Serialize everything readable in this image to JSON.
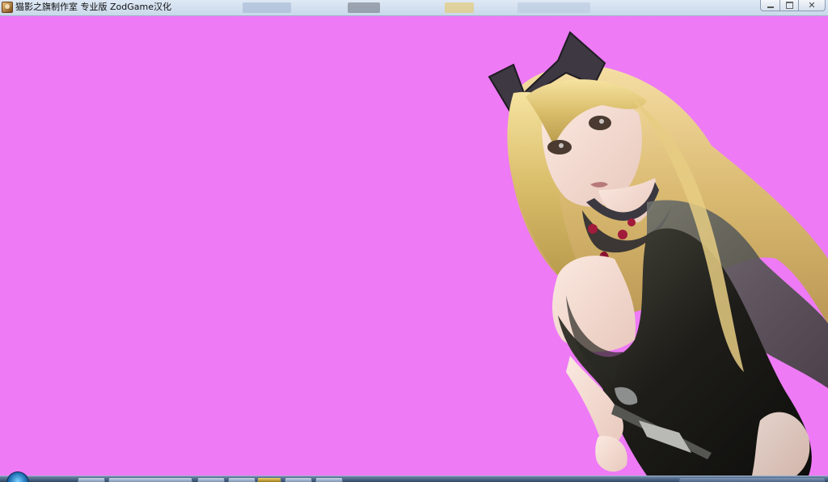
{
  "window": {
    "title": "猫影之旗制作室 专业版 ZodGame汉化",
    "controls": {
      "minimize_icon": "minimize-icon",
      "maximize_icon": "maximize-icon",
      "close_icon": "close-icon"
    }
  },
  "viewport": {
    "background_color": "#ee7af6",
    "content": "3d-character-render"
  },
  "colors": {
    "canvas_background": "#ee7af6",
    "titlebar": "#d2dfee",
    "taskbar": "#3f5877"
  },
  "taskbar": {
    "start_icon": "windows-orb-icon",
    "items": [
      {
        "icon": "app-icon-1"
      },
      {
        "icon": "app-icon-2"
      },
      {
        "icon": "app-icon-3"
      },
      {
        "icon": "app-icon-4"
      },
      {
        "icon": "app-icon-5"
      },
      {
        "icon": "app-icon-6"
      },
      {
        "icon": "app-icon-7"
      },
      {
        "icon": "app-icon-8"
      }
    ]
  }
}
